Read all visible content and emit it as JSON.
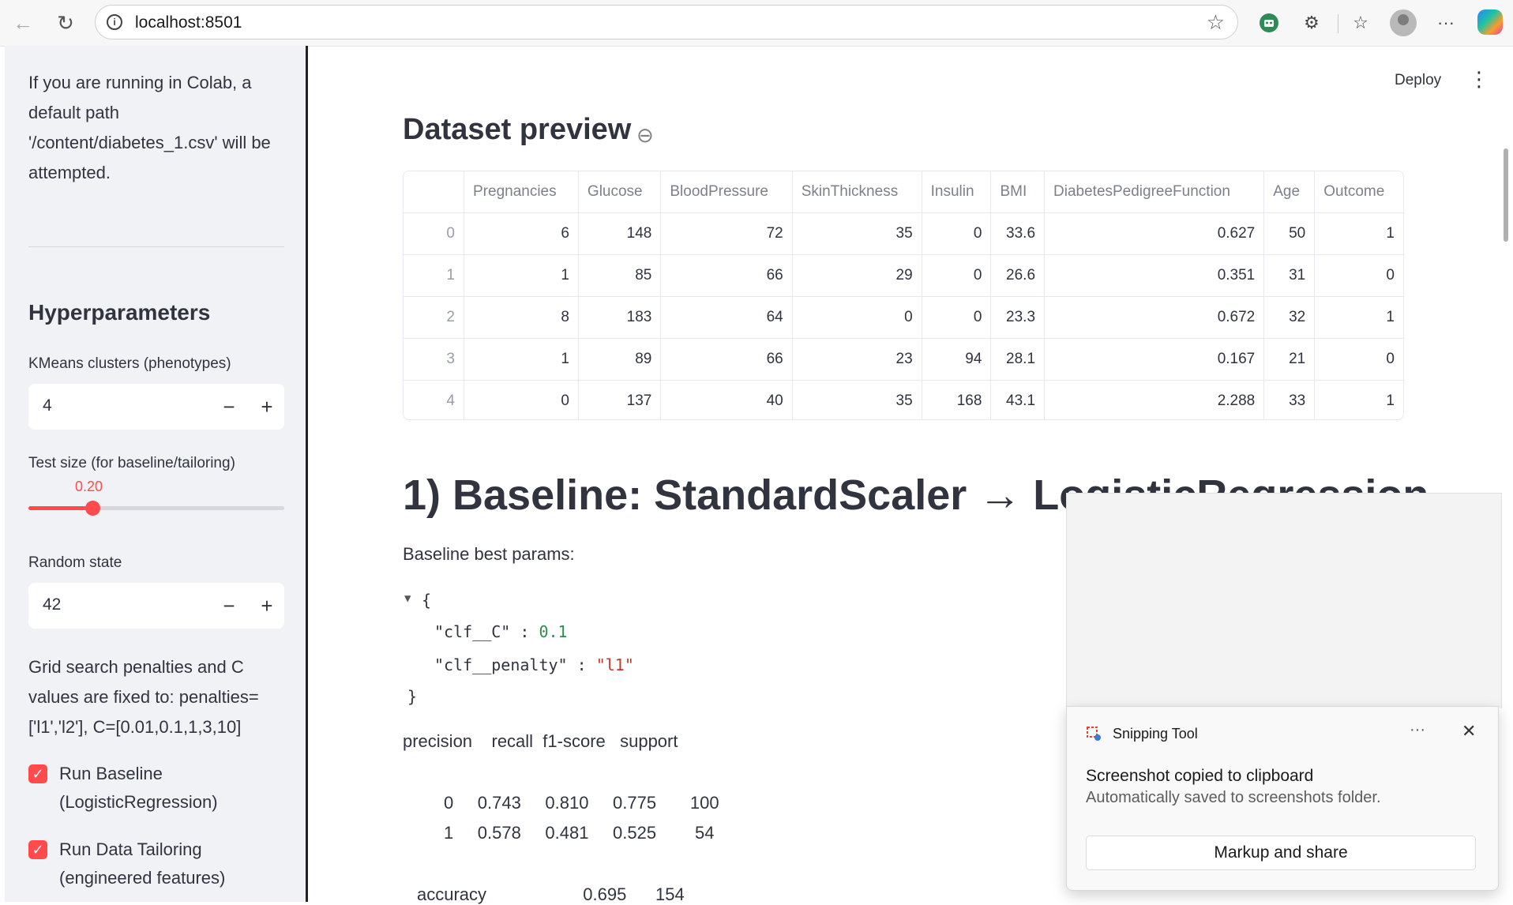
{
  "browser": {
    "url": "localhost:8501"
  },
  "sidebar": {
    "info_lines": [
      "If you are running in Colab, a",
      "default path",
      "'/content/diabetes_1.csv' will be",
      "attempted."
    ],
    "hyper_heading": "Hyperparameters",
    "kmeans_label": "KMeans clusters (phenotypes)",
    "kmeans_value": "4",
    "test_size_label": "Test size (for baseline/tailoring)",
    "test_size_value": "0.20",
    "test_size_fraction": 0.25,
    "random_state_label": "Random state",
    "random_state_value": "42",
    "grid_lines": [
      "Grid search penalties and C",
      "values are fixed to: penalties=",
      "['l1','l2'], C=[0.01,0.1,1,3,10]"
    ],
    "checkbox_baseline": [
      "Run Baseline",
      "(LogisticRegression)"
    ],
    "checkbox_tailoring": [
      "Run Data Tailoring",
      "(engineered features)"
    ],
    "stepper_minus": "−",
    "stepper_plus": "+"
  },
  "header": {
    "deploy": "Deploy"
  },
  "main": {
    "preview_heading": "Dataset preview",
    "table": {
      "columns": [
        "",
        "Pregnancies",
        "Glucose",
        "BloodPressure",
        "SkinThickness",
        "Insulin",
        "BMI",
        "DiabetesPedigreeFunction",
        "Age",
        "Outcome"
      ],
      "rows": [
        [
          "0",
          "6",
          "148",
          "72",
          "35",
          "0",
          "33.6",
          "0.627",
          "50",
          "1"
        ],
        [
          "1",
          "1",
          "85",
          "66",
          "29",
          "0",
          "26.6",
          "0.351",
          "31",
          "0"
        ],
        [
          "2",
          "8",
          "183",
          "64",
          "0",
          "0",
          "23.3",
          "0.672",
          "32",
          "1"
        ],
        [
          "3",
          "1",
          "89",
          "66",
          "23",
          "94",
          "28.1",
          "0.167",
          "21",
          "0"
        ],
        [
          "4",
          "0",
          "137",
          "40",
          "35",
          "168",
          "43.1",
          "2.288",
          "33",
          "1"
        ]
      ]
    },
    "baseline_heading": "1) Baseline: StandardScaler → LogisticRegression",
    "best_params_label": "Baseline best params:",
    "json": {
      "open": "{",
      "close": "}",
      "k1": "\"clf__C\"",
      "v1": "0.1",
      "k2": "\"clf__penalty\"",
      "v2": "\"l1\"",
      "colon": ":"
    },
    "report": {
      "header": "precision    recall  f1-score   support",
      "row0": "0     0.743     0.810     0.775       100",
      "row1": "1     0.578     0.481     0.525        54",
      "accuracy": "accuracy                    0.695      154"
    }
  },
  "toast": {
    "app_name": "Snipping Tool",
    "title": "Screenshot copied to clipboard",
    "subtitle": "Automatically saved to screenshots folder.",
    "button": "Markup and share",
    "more": "···",
    "close": "✕"
  }
}
